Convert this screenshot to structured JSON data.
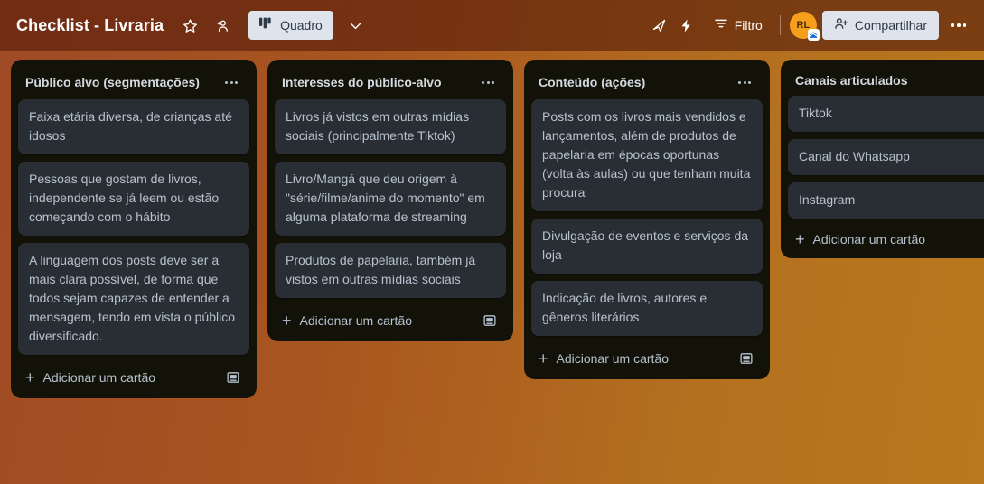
{
  "header": {
    "board_title": "Checklist - Livraria",
    "star_icon": "star-icon",
    "visibility_icon": "members-icon",
    "view_button_label": "Quadro",
    "view_button_icon": "board-columns-icon",
    "view_chevron_icon": "chevron-down-icon",
    "rocket_icon": "rocket-icon",
    "automation_icon": "lightning-bolt-icon",
    "filter_label": "Filtro",
    "filter_icon": "filter-icon",
    "avatar_initials": "RL",
    "avatar_color": "#f59f1a",
    "share_label": "Compartilhar",
    "share_icon": "person-add-icon",
    "menu_icon": "ellipsis-horizontal-icon"
  },
  "board": {
    "background_gradient_start": "#a04a26",
    "background_gradient_end": "#b9781d",
    "list_background": "#121208",
    "card_background": "#282e33",
    "add_card_label": "Adicionar um cartão",
    "lists": [
      {
        "title": "Público alvo (segmentações)",
        "cards": [
          "Faixa etária diversa, de crianças até idosos",
          "Pessoas que gostam de livros, independente se já leem ou estão começando com o hábito",
          "A linguagem dos posts deve ser a mais clara possível, de forma que todos sejam capazes de entender a mensagem, tendo em vista o público diversificado."
        ],
        "show_template_icon": true
      },
      {
        "title": "Interesses do público-alvo",
        "cards": [
          "Livros já vistos em outras mídias sociais (principalmente Tiktok)",
          "Livro/Mangá que deu origem à \"série/filme/anime do momento\" em alguma plataforma de streaming",
          "Produtos de papelaria, também já vistos em outras mídias sociais"
        ],
        "show_template_icon": true
      },
      {
        "title": "Conteúdo (ações)",
        "cards": [
          "Posts com os livros mais vendidos e lançamentos, além de produtos de papelaria em épocas oportunas (volta às aulas) ou que tenham muita procura",
          "Divulgação de eventos e serviços da loja",
          "Indicação de livros, autores e gêneros literários"
        ],
        "show_template_icon": true
      },
      {
        "title": "Canais articulados",
        "cards": [
          "Tiktok",
          "Canal do Whatsapp",
          "Instagram"
        ],
        "show_template_icon": false
      }
    ]
  }
}
